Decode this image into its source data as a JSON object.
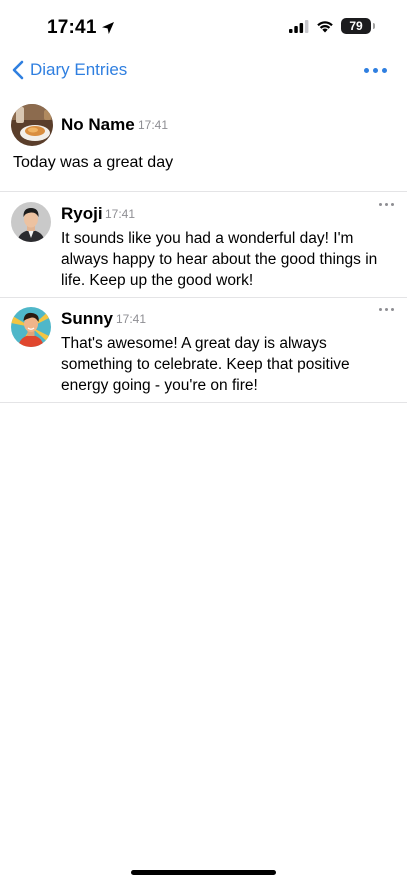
{
  "status_bar": {
    "time": "17:41",
    "battery": "79",
    "icons": [
      "location-arrow-icon",
      "cellular-signal-icon",
      "wifi-icon",
      "battery-icon"
    ]
  },
  "nav": {
    "back_label": "Diary Entries",
    "back_icon": "chevron-left-icon",
    "more_icon": "ellipsis-icon",
    "accent_color": "#2f7fe0"
  },
  "entry": {
    "author": "No Name",
    "time": "17:41",
    "text": "Today was a great day"
  },
  "comments": [
    {
      "author": "Ryoji",
      "time": "17:41",
      "text": "It sounds like you had a wonderful day! I'm always happy to hear about the good things in life. Keep up the good work!"
    },
    {
      "author": "Sunny",
      "time": "17:41",
      "text": "That's awesome!  A great day is always something to celebrate.  Keep that positive energy going - you're on fire!"
    }
  ]
}
